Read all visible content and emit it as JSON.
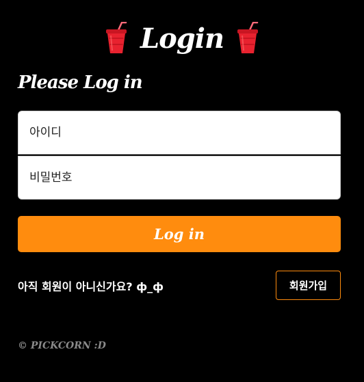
{
  "header": {
    "title": "Login",
    "left_icon": "cup-with-straw-icon",
    "right_icon": "cup-with-straw-icon"
  },
  "form": {
    "heading": "Please Log in",
    "id_placeholder": "아이디",
    "password_placeholder": "비밀번호",
    "login_label": "Log in"
  },
  "signup": {
    "prompt": "아직 회원이 아니신가요? ф_ф",
    "button_label": "회원가입"
  },
  "footer": {
    "copyright": "© PICKCORN :D"
  },
  "colors": {
    "background": "#000000",
    "accent": "#ff8c0e",
    "cup_red": "#e8222f",
    "straw": "#e8222f"
  }
}
